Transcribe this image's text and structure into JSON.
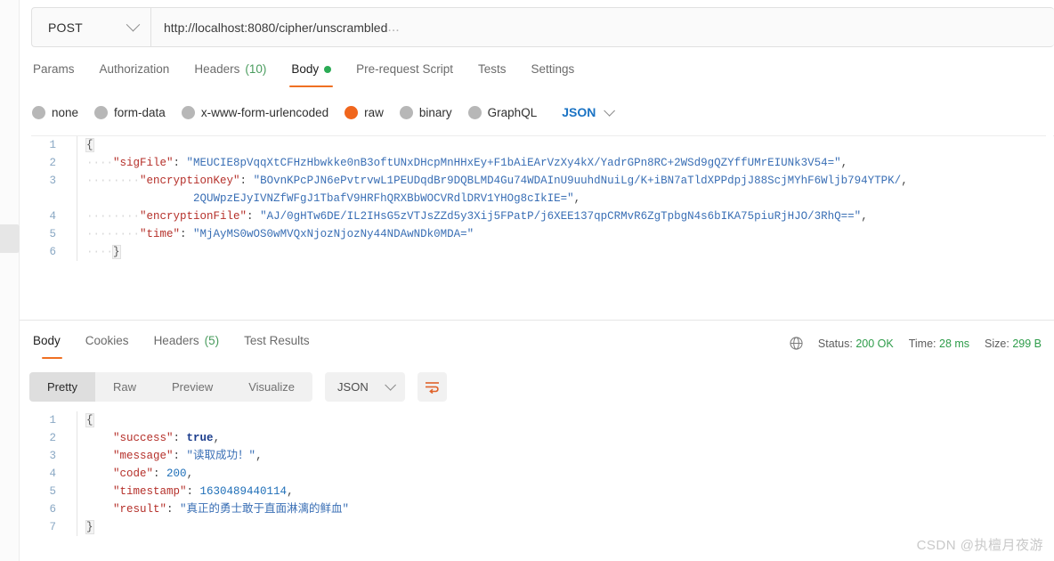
{
  "request": {
    "method": "POST",
    "url": "http://localhost:8080/cipher/unscrambled",
    "url_ellipsis": "...",
    "tabs": [
      {
        "label": "Params",
        "count": "",
        "active": false,
        "dot": false
      },
      {
        "label": "Authorization",
        "count": "",
        "active": false,
        "dot": false
      },
      {
        "label": "Headers",
        "count": "(10)",
        "active": false,
        "dot": false
      },
      {
        "label": "Body",
        "count": "",
        "active": true,
        "dot": true
      },
      {
        "label": "Pre-request Script",
        "count": "",
        "active": false,
        "dot": false
      },
      {
        "label": "Tests",
        "count": "",
        "active": false,
        "dot": false
      },
      {
        "label": "Settings",
        "count": "",
        "active": false,
        "dot": false
      }
    ],
    "body_types": [
      {
        "label": "none",
        "selected": false
      },
      {
        "label": "form-data",
        "selected": false
      },
      {
        "label": "x-www-form-urlencoded",
        "selected": false
      },
      {
        "label": "raw",
        "selected": true
      },
      {
        "label": "binary",
        "selected": false
      },
      {
        "label": "GraphQL",
        "selected": false
      }
    ],
    "format": "JSON",
    "body_lines": [
      {
        "num": "1",
        "open": "{"
      },
      {
        "num": "2",
        "indent": "····",
        "key": "\"sigFile\"",
        "sep": ": ",
        "value": "\"MEUCIE8pVqqXtCFHzHbwkke0nB3oftUNxDHcpMnHHxEy+F1bAiEArVzXy4kX/YadrGPn8RC+2WSd9gQZYffUMrEIUNk3V54=\"",
        "comma": ","
      },
      {
        "num": "3",
        "indent": "········",
        "key": "\"encryptionKey\"",
        "sep": ": ",
        "value": "\"BOvnKPcPJN6ePvtrvwL1PEUDqdBr9DQBLMD4Gu74WDAInU9uuhdNuiLg/K+iBN7aTldXPPdpjJ88ScjMYhF6Wljb794YTPK/",
        "value_wrap": "2QUWpzEJyIVNZfWFgJ1TbafV9HRFhQRXBbWOCVRdlDRV1YHOg8cIkIE=\"",
        "comma": ","
      },
      {
        "num": "4",
        "indent": "········",
        "key": "\"encryptionFile\"",
        "sep": ": ",
        "value": "\"AJ/0gHTw6DE/IL2IHsG5zVTJsZZd5y3Xij5FPatP/j6XEE137qpCRMvR6ZgTpbgN4s6bIKA75piuRjHJO/3RhQ==\"",
        "comma": ","
      },
      {
        "num": "5",
        "indent": "········",
        "key": "\"time\"",
        "sep": ": ",
        "value": "\"MjAyMS0wOS0wMVQxNjozNjozNy44NDAwNDk0MDA=\"",
        "comma": ""
      },
      {
        "num": "6",
        "indent": "····",
        "close": "}"
      }
    ]
  },
  "response": {
    "tabs": [
      {
        "label": "Body",
        "count": "",
        "active": true
      },
      {
        "label": "Cookies",
        "count": "",
        "active": false
      },
      {
        "label": "Headers",
        "count": "(5)",
        "active": false
      },
      {
        "label": "Test Results",
        "count": "",
        "active": false
      }
    ],
    "status_label": "Status:",
    "status_value": "200 OK",
    "time_label": "Time:",
    "time_value": "28 ms",
    "size_label": "Size:",
    "size_value": "299 B",
    "views": [
      {
        "label": "Pretty",
        "active": true
      },
      {
        "label": "Raw",
        "active": false
      },
      {
        "label": "Preview",
        "active": false
      },
      {
        "label": "Visualize",
        "active": false
      }
    ],
    "format": "JSON",
    "body_lines": [
      {
        "num": "1",
        "open": "{"
      },
      {
        "num": "2",
        "indent": "    ",
        "key": "\"success\"",
        "sep": ": ",
        "bool": "true",
        "comma": ","
      },
      {
        "num": "3",
        "indent": "    ",
        "key": "\"message\"",
        "sep": ": ",
        "value": "\"读取成功！\"",
        "comma": ","
      },
      {
        "num": "4",
        "indent": "    ",
        "key": "\"code\"",
        "sep": ": ",
        "number": "200",
        "comma": ","
      },
      {
        "num": "5",
        "indent": "    ",
        "key": "\"timestamp\"",
        "sep": ": ",
        "number": "1630489440114",
        "comma": ","
      },
      {
        "num": "6",
        "indent": "    ",
        "key": "\"result\"",
        "sep": ": ",
        "value": "\"真正的勇士敢于直面淋漓的鲜血\"",
        "comma": ""
      },
      {
        "num": "7",
        "close": "}"
      }
    ]
  },
  "watermark": "CSDN @执檀月夜游",
  "colors": {
    "accent": "#ef7022",
    "green": "#2e9c4a",
    "link": "#1a73c4"
  }
}
